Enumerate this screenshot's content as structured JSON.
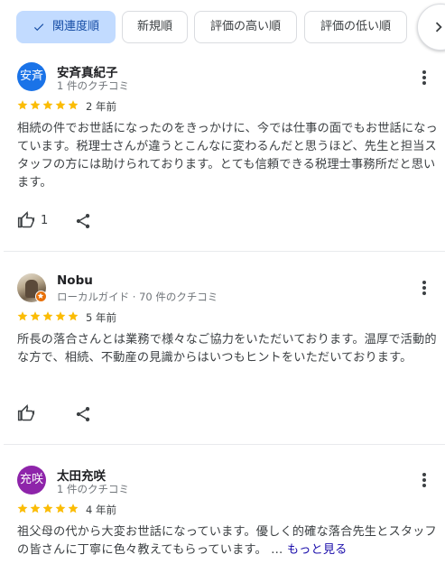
{
  "sort_chips": [
    {
      "label": "関連度順",
      "selected": true,
      "icon": "check-icon"
    },
    {
      "label": "新規順",
      "selected": false
    },
    {
      "label": "評価の高い順",
      "selected": false
    },
    {
      "label": "評価の低い順",
      "selected": false
    }
  ],
  "scroll_icon": "chevron-right-icon",
  "colors": {
    "selected_chip_bg": "#c2dbff",
    "star": "#fbbc04",
    "link": "#1a0dab",
    "avatar_1": "#1a73e8",
    "avatar_3": "#8e24aa",
    "local_guide_badge": "#e8710a"
  },
  "reviews": [
    {
      "avatar_text": "安斉",
      "name": "安斉真紀子",
      "meta": "1 件のクチコミ",
      "rating": 5,
      "when": "2 年前",
      "text": "相続の件でお世話になったのをきっかけに、今では仕事の面でもお世話になっています。税理士さんが違うとこんなに変わるんだと思うほど、先生と担当スタッフの方には助けられております。とても信頼できる税理士事務所だと思います。",
      "likes": "1"
    },
    {
      "avatar_text": "",
      "name": "Nobu",
      "meta": "ローカルガイド · 70 件のクチコミ",
      "rating": 5,
      "when": "5 年前",
      "text": "所長の落合さんとは業務で様々なご協力をいただいております。温厚で活動的な方で、相続、不動産の見識からはいつもヒントをいただいております。",
      "likes": ""
    },
    {
      "avatar_text": "充咲",
      "name": "太田充咲",
      "meta": "1 件のクチコミ",
      "rating": 5,
      "when": "4 年前",
      "text": "祖父母の代から大変お世話になっています。優しく的確な落合先生とスタッフの皆さんに丁寧に色々教えてもらっています。",
      "ellipsis": " …",
      "more_label": "もっと見る",
      "likes": ""
    }
  ]
}
